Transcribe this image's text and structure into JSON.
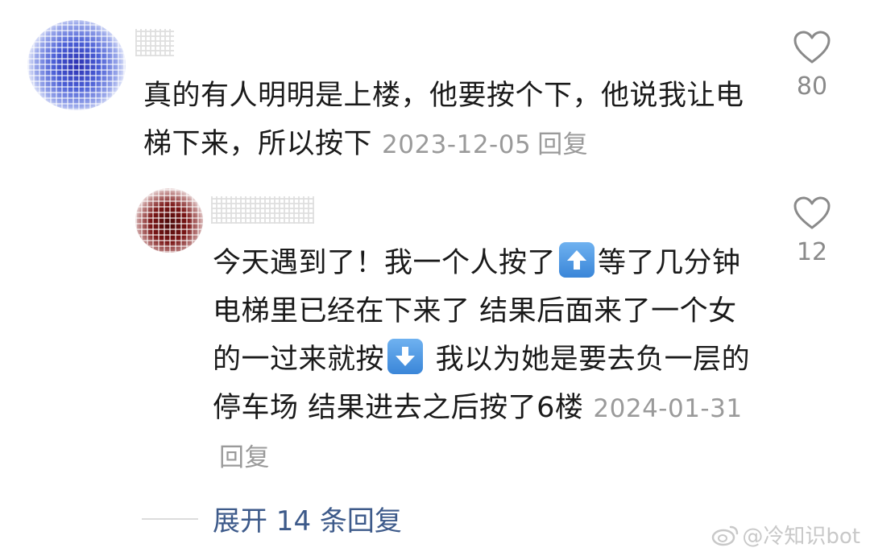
{
  "comments": [
    {
      "text": "真的有人明明是上楼，他要按个下，他说我让电梯下来，所以按下",
      "date": "2023-12-05",
      "reply_label": "回复",
      "likes": "80"
    },
    {
      "text_part1": "今天遇到了！我一个人按了",
      "emoji_1": "up-arrow-emoji",
      "text_part2": "等了几分钟电梯里已经在下来了 结果后面来了一个女的一过来就按",
      "emoji_2": "down-arrow-emoji",
      "text_part3": " 我以为她是要去负一层的停车场 结果进去之后按了6楼",
      "date": "2024-01-31",
      "reply_label": "回复",
      "likes": "12"
    }
  ],
  "expand": {
    "label": "展开 14 条回复"
  },
  "watermark": {
    "text": "@冷知识bot",
    "icon": "weibo-icon"
  },
  "colors": {
    "accent": "#3d5a8a",
    "meta": "#9a9a9a"
  }
}
